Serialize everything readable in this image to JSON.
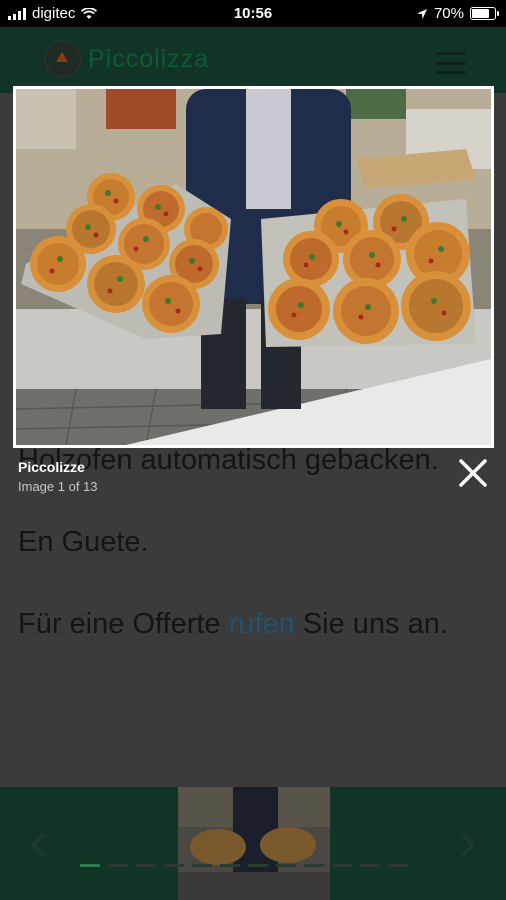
{
  "status_bar": {
    "carrier": "digitec",
    "time": "10:56",
    "battery": "70%"
  },
  "header": {
    "logo_text": "Piccolizza",
    "menu_icon": "hamburger-icon"
  },
  "page": {
    "paragraph_1": "Holzofen automatisch gebacken.",
    "paragraph_2": "En Guete.",
    "paragraph_3_before": "Für eine Offerte ",
    "paragraph_3_link": "rufen",
    "paragraph_3_after": " Sie uns an."
  },
  "lightbox": {
    "title": "Piccolizze",
    "counter": "Image 1 of 13",
    "close_icon": "close-icon"
  },
  "gallery": {
    "prev_icon": "chevron-left-icon",
    "next_icon": "chevron-right-icon"
  }
}
